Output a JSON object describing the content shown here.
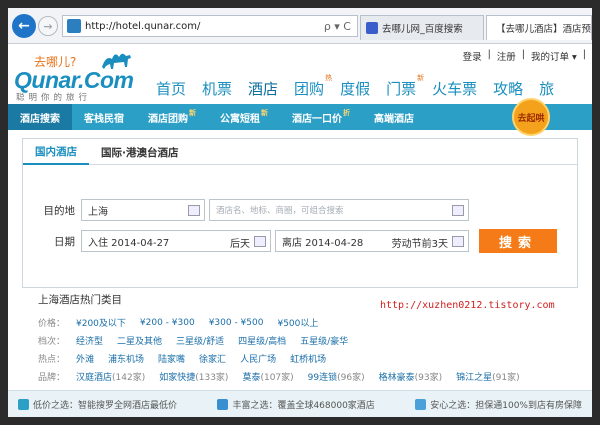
{
  "browser": {
    "url": "http://hotel.qunar.com/",
    "tools": "ρ ▾ C",
    "tabs": [
      {
        "label": "去哪儿网_百度搜索"
      },
      {
        "label": "【去哪儿酒店】酒店预"
      }
    ]
  },
  "header": {
    "logo_small": "去哪儿?",
    "logo_brand": "Qunar.Com",
    "logo_sub": "聪明你的旅行",
    "top_links": [
      "登录",
      "注册",
      "我的订单 ▾",
      "|"
    ],
    "nav": [
      {
        "label": "首页",
        "badge": ""
      },
      {
        "label": "机票",
        "badge": ""
      },
      {
        "label": "酒店",
        "badge": ""
      },
      {
        "label": "团购",
        "badge": "热"
      },
      {
        "label": "度假",
        "badge": ""
      },
      {
        "label": "门票",
        "badge": "新"
      },
      {
        "label": "火车票",
        "badge": ""
      },
      {
        "label": "攻略",
        "badge": ""
      },
      {
        "label": "旅",
        "badge": ""
      }
    ]
  },
  "subnav": {
    "items": [
      {
        "label": "酒店搜索",
        "hot": ""
      },
      {
        "label": "客栈民宿",
        "hot": ""
      },
      {
        "label": "酒店团购",
        "hot": "新"
      },
      {
        "label": "公寓短租",
        "hot": "新"
      },
      {
        "label": "酒店一口价",
        "hot": "折"
      },
      {
        "label": "高端酒店",
        "hot": ""
      }
    ],
    "promo": "去起哄"
  },
  "search": {
    "tabs": [
      "国内酒店",
      "国际·港澳台酒店"
    ],
    "dest_label": "目的地",
    "dest_value": "上海",
    "keyword_placeholder": "酒店名、地标、商圈，可组合搜索",
    "date_label": "日期",
    "checkin": "入住 2014-04-27",
    "checkin_note": "后天",
    "checkout": "离店 2014-04-28",
    "checkout_note": "劳动节前3天",
    "button": "搜索"
  },
  "popular": {
    "title": "上海酒店热门类目",
    "watermark": "http://xuzhen0212.tistory.com",
    "rows": [
      {
        "label": "价格：",
        "items": [
          {
            "t": "¥200及以下",
            "c": ""
          },
          {
            "t": "¥200 - ¥300",
            "c": ""
          },
          {
            "t": "¥300 - ¥500",
            "c": ""
          },
          {
            "t": "¥500以上",
            "c": ""
          }
        ]
      },
      {
        "label": "档次：",
        "items": [
          {
            "t": "经济型",
            "c": ""
          },
          {
            "t": "二星及其他",
            "c": ""
          },
          {
            "t": "三星级/舒适",
            "c": ""
          },
          {
            "t": "四星级/高档",
            "c": ""
          },
          {
            "t": "五星级/豪华",
            "c": ""
          }
        ]
      },
      {
        "label": "热点：",
        "items": [
          {
            "t": "外滩",
            "c": ""
          },
          {
            "t": "浦东机场",
            "c": ""
          },
          {
            "t": "陆家嘴",
            "c": ""
          },
          {
            "t": "徐家汇",
            "c": ""
          },
          {
            "t": "人民广场",
            "c": ""
          },
          {
            "t": "虹桥机场",
            "c": ""
          }
        ]
      },
      {
        "label": "品牌：",
        "items": [
          {
            "t": "汉庭酒店",
            "c": "(142家)"
          },
          {
            "t": "如家快捷",
            "c": "(133家)"
          },
          {
            "t": "莫泰",
            "c": "(107家)"
          },
          {
            "t": "99连锁",
            "c": "(96家)"
          },
          {
            "t": "格林豪泰",
            "c": "(93家)"
          },
          {
            "t": "锦江之星",
            "c": "(91家)"
          }
        ]
      }
    ]
  },
  "bottom": [
    {
      "label": "低价之选：智能搜罗全网酒店最低价"
    },
    {
      "label": "丰富之选：覆盖全球468000家酒店"
    },
    {
      "label": "安心之选：担保通100%到店有房保障"
    }
  ],
  "colors": {
    "accent": "#2b9fc6",
    "brand": "#1a8fbf",
    "button": "#f47b17"
  }
}
